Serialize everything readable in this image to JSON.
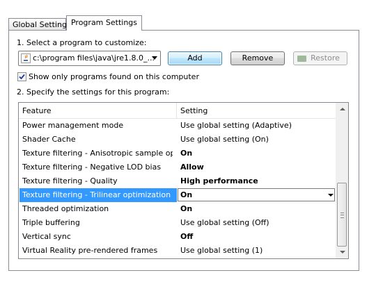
{
  "tabs": [
    {
      "label": "Global Settings",
      "active": false
    },
    {
      "label": "Program Settings",
      "active": true
    }
  ],
  "step1": {
    "label": "1. Select a program to customize:"
  },
  "program_select": {
    "value": "c:\\program files\\java\\jre1.8.0_..."
  },
  "buttons": {
    "add": "Add",
    "remove": "Remove",
    "restore": "Restore"
  },
  "show_only": {
    "label": "Show only programs found on this computer",
    "checked": true
  },
  "step2": {
    "label": "2. Specify the settings for this program:"
  },
  "table": {
    "columns": [
      "Feature",
      "Setting"
    ],
    "rows": [
      {
        "feature": "Power management mode",
        "setting": "Use global setting (Adaptive)",
        "bold": false
      },
      {
        "feature": "Shader Cache",
        "setting": "Use global setting (On)",
        "bold": false
      },
      {
        "feature": "Texture filtering - Anisotropic sample opti...",
        "setting": "On",
        "bold": true
      },
      {
        "feature": "Texture filtering - Negative LOD bias",
        "setting": "Allow",
        "bold": true
      },
      {
        "feature": "Texture filtering - Quality",
        "setting": "High performance",
        "bold": true
      },
      {
        "feature": "Texture filtering - Trilinear optimization",
        "setting": "On",
        "bold": true,
        "selected": true
      },
      {
        "feature": "Threaded optimization",
        "setting": "On",
        "bold": true
      },
      {
        "feature": "Triple buffering",
        "setting": "Use global setting (Off)",
        "bold": false
      },
      {
        "feature": "Vertical sync",
        "setting": "Off",
        "bold": true
      },
      {
        "feature": "Virtual Reality pre-rendered frames",
        "setting": "Use global setting (1)",
        "bold": false
      }
    ]
  },
  "colors": {
    "selection": "#3399ff",
    "accent_button": "#3c7fb1"
  }
}
